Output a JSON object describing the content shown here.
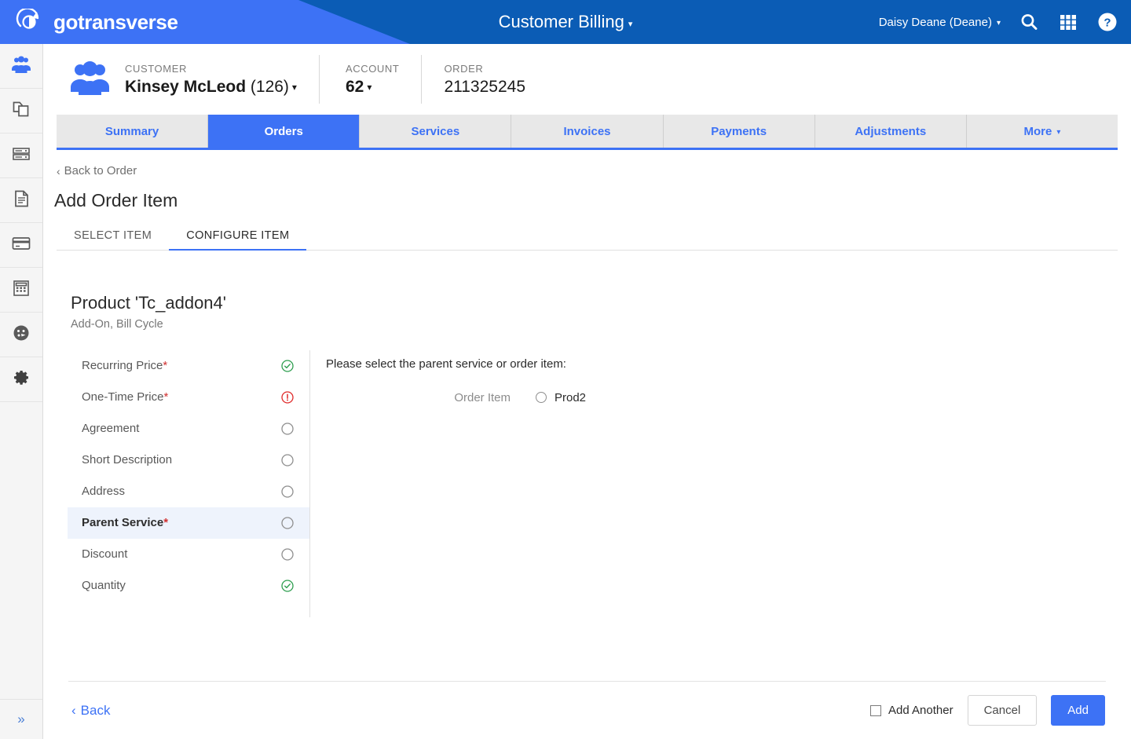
{
  "header": {
    "brand": "gotransverse",
    "brand_logo_icon": "circular-arrow-logo-icon",
    "app_title": "Customer Billing",
    "app_title_caret": "▾",
    "user": "Daisy Deane (Deane)",
    "user_caret": "▾",
    "icons": [
      "search-icon",
      "apps-grid-icon",
      "help-circle-icon"
    ]
  },
  "sidebar": {
    "items": [
      {
        "icon": "customers-people-icon",
        "active": true
      },
      {
        "icon": "products-copy-icon",
        "active": false
      },
      {
        "icon": "servers-stack-icon",
        "active": false
      },
      {
        "icon": "documents-page-icon",
        "active": false
      },
      {
        "icon": "billing-card-icon",
        "active": false
      },
      {
        "icon": "calculator-icon",
        "active": false
      },
      {
        "icon": "dashboard-gauge-icon",
        "active": false
      },
      {
        "icon": "settings-gear-icon",
        "active": false
      }
    ],
    "expand_icon": "double-chevron-right-icon"
  },
  "entity_bar": {
    "icon": "customer-group-icon",
    "customer_label": "CUSTOMER",
    "customer_name": "Kinsey McLeod",
    "customer_id": "(126)",
    "customer_caret": "▾",
    "account_label": "ACCOUNT",
    "account_value": "62",
    "account_caret": "▾",
    "order_label": "ORDER",
    "order_value": "211325245"
  },
  "tabs": [
    {
      "label": "Summary",
      "active": false,
      "caret": ""
    },
    {
      "label": "Orders",
      "active": true,
      "caret": ""
    },
    {
      "label": "Services",
      "active": false,
      "caret": ""
    },
    {
      "label": "Invoices",
      "active": false,
      "caret": ""
    },
    {
      "label": "Payments",
      "active": false,
      "caret": ""
    },
    {
      "label": "Adjustments",
      "active": false,
      "caret": ""
    },
    {
      "label": "More",
      "active": false,
      "caret": "▾"
    }
  ],
  "page": {
    "back_link": "Back to Order",
    "back_chevron": "‹",
    "title": "Add Order Item",
    "subtabs": [
      {
        "label": "SELECT ITEM",
        "active": false
      },
      {
        "label": "CONFIGURE ITEM",
        "active": true
      }
    ],
    "product_title": "Product 'Tc_addon4'",
    "product_subtitle": "Add-On, Bill Cycle"
  },
  "steps": [
    {
      "label": "Recurring Price",
      "required": "*",
      "status": "complete",
      "selected": false
    },
    {
      "label": "One-Time Price",
      "required": "*",
      "status": "error",
      "selected": false
    },
    {
      "label": "Agreement",
      "required": "",
      "status": "incomplete",
      "selected": false
    },
    {
      "label": "Short Description",
      "required": "",
      "status": "incomplete",
      "selected": false
    },
    {
      "label": "Address",
      "required": "",
      "status": "incomplete",
      "selected": false
    },
    {
      "label": "Parent Service",
      "required": "*",
      "status": "incomplete",
      "selected": true
    },
    {
      "label": "Discount",
      "required": "",
      "status": "incomplete",
      "selected": false
    },
    {
      "label": "Quantity",
      "required": "",
      "status": "complete",
      "selected": false
    }
  ],
  "detail": {
    "prompt": "Please select the parent service or order item:",
    "group_label": "Order Item",
    "option_label": "Prod2",
    "option_selected": false
  },
  "footer": {
    "back_label": "Back",
    "back_chevron": "‹",
    "add_another_label": "Add Another",
    "add_another_checked": false,
    "cancel_label": "Cancel",
    "add_label": "Add"
  },
  "colors": {
    "brand_blue": "#0b5cb5",
    "accent_blue": "#3d72f5",
    "status_ok": "#2e9e4f",
    "status_error": "#e02a2a",
    "required_red": "#d03030"
  }
}
